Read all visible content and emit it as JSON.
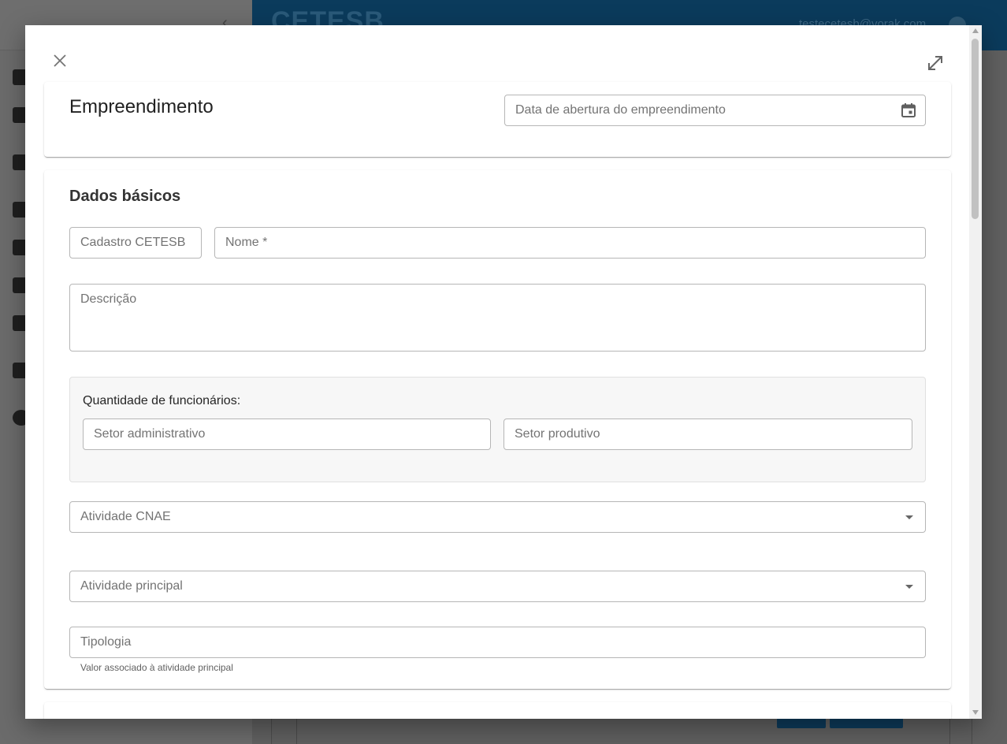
{
  "background": {
    "logo": "CETESB",
    "user_email": "testecetesb@vorak.com"
  },
  "dialog": {
    "close_icon": "close-icon",
    "expand_icon": "expand-icon",
    "empreendimento": {
      "title": "Empreendimento",
      "data_abertura": {
        "placeholder": "Data de abertura do empreendimento",
        "icon": "calendar-icon"
      }
    },
    "dados_basicos": {
      "title": "Dados básicos",
      "cadastro": {
        "placeholder": "Cadastro CETESB"
      },
      "nome": {
        "placeholder": "Nome",
        "required_mark": "*"
      },
      "descricao": {
        "placeholder": "Descrição"
      },
      "funcionarios": {
        "label": "Quantidade de funcionários:",
        "administrativo": {
          "placeholder": "Setor administrativo"
        },
        "produtivo": {
          "placeholder": "Setor produtivo"
        }
      },
      "atividade_cnae": {
        "placeholder": "Atividade CNAE",
        "icon": "dropdown-arrow-icon"
      },
      "atividade_principal": {
        "placeholder": "Atividade principal",
        "icon": "dropdown-arrow-icon"
      },
      "tipologia": {
        "placeholder": "Tipologia",
        "hint": "Valor associado à atividade principal"
      }
    }
  },
  "colors": {
    "brand": "#0b3b5c",
    "border": "#b6b6b6",
    "placeholder": "#737373"
  }
}
